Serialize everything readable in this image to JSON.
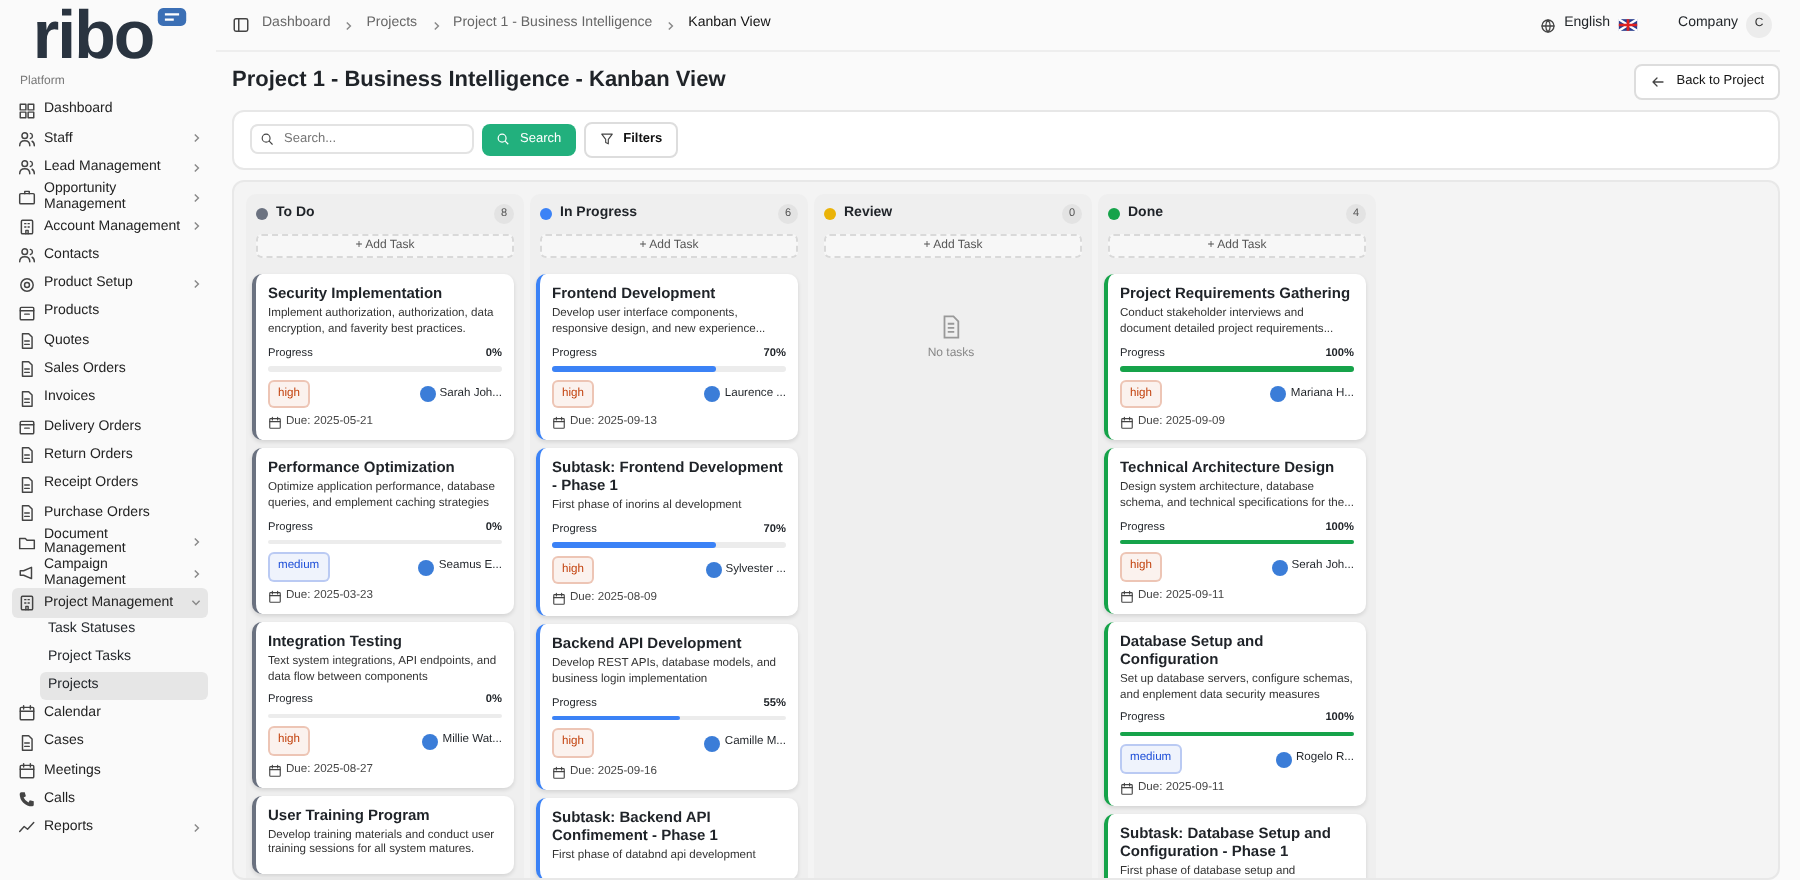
{
  "sidebar": {
    "logo": "ribo",
    "section": "Platform",
    "items": [
      {
        "label": "Dashboard",
        "kind": "link",
        "selected": false
      },
      {
        "label": "Staff",
        "kind": "group",
        "expanded": false,
        "selected": false
      },
      {
        "label": "Lead Management",
        "kind": "group",
        "expanded": false,
        "selected": false
      },
      {
        "label": "Opportunity Management",
        "kind": "group",
        "expanded": false,
        "selected": false
      },
      {
        "label": "Account Management",
        "kind": "group",
        "expanded": false,
        "selected": false
      },
      {
        "label": "Contacts",
        "kind": "link",
        "selected": false
      },
      {
        "label": "Product Setup",
        "kind": "group",
        "expanded": false,
        "selected": false
      },
      {
        "label": "Products",
        "kind": "link",
        "selected": false
      },
      {
        "label": "Quotes",
        "kind": "link",
        "selected": false
      },
      {
        "label": "Sales Orders",
        "kind": "link",
        "selected": false
      },
      {
        "label": "Invoices",
        "kind": "link",
        "selected": false
      },
      {
        "label": "Delivery Orders",
        "kind": "link",
        "selected": false
      },
      {
        "label": "Return Orders",
        "kind": "link",
        "selected": false
      },
      {
        "label": "Receipt Orders",
        "kind": "link",
        "selected": false
      },
      {
        "label": "Purchase Orders",
        "kind": "link",
        "selected": false
      },
      {
        "label": "Document Management",
        "kind": "group",
        "expanded": false,
        "selected": false
      },
      {
        "label": "Campaign Management",
        "kind": "group",
        "expanded": false,
        "selected": false
      },
      {
        "label": "Project Management",
        "kind": "group",
        "expanded": true,
        "selected": true,
        "children": [
          {
            "label": "Task Statuses",
            "selected": false
          },
          {
            "label": "Project Tasks",
            "selected": false
          },
          {
            "label": "Projects",
            "selected": true
          }
        ]
      },
      {
        "label": "Calendar",
        "kind": "link",
        "selected": false
      },
      {
        "label": "Cases",
        "kind": "link",
        "selected": false
      },
      {
        "label": "Meetings",
        "kind": "link",
        "selected": false
      },
      {
        "label": "Calls",
        "kind": "link",
        "selected": false
      },
      {
        "label": "Reports",
        "kind": "group",
        "expanded": false,
        "selected": false
      }
    ]
  },
  "breadcrumbs": [
    "Dashboard",
    "Projects",
    "Project 1 - Business Intelligence",
    "Kanban View"
  ],
  "header": {
    "language": "English",
    "company": "Company",
    "avatar": "C"
  },
  "title": "Project 1 - Business Intelligence - Kanban View",
  "back_button": "Back to Project",
  "search": {
    "placeholder": "Search...",
    "button": "Search",
    "filters": "Filters"
  },
  "columns": [
    {
      "name": "To Do",
      "count": "8",
      "color": "#6b7280",
      "add": "+ Add Task",
      "cards": [
        {
          "title": "Security Implementation",
          "description": "Implement authorization, authorization, data encryption, and faverity best practices.",
          "progress_label": "Progress",
          "progress": "0%",
          "level": 0,
          "priority": {
            "label": "high",
            "color": "#c2410c"
          },
          "assignee": "Sarah Joh...",
          "due": "Due: 2025-05-21"
        },
        {
          "title": "Performance Optimization",
          "description": "Optimize application performance, database queries, and emplement caching strategies",
          "progress_label": "Progress",
          "progress": "0%",
          "level": 0,
          "priority": {
            "label": "medium",
            "color": "#1d4ed8"
          },
          "assignee": "Seamus E...",
          "due": "Due: 2025-03-23"
        },
        {
          "title": "Integration Testing",
          "description": "Text system integrations, API endpoints, and data flow between components",
          "progress_label": "Progress",
          "progress": "0%",
          "level": 0,
          "priority": {
            "label": "high",
            "color": "#c2410c"
          },
          "assignee": "Millie Wat...",
          "due": "Due: 2025-08-27"
        },
        {
          "title": "User Training Program",
          "description": "Develop training materials and conduct user training sessions for all system matures."
        }
      ]
    },
    {
      "name": "In Progress",
      "count": "6",
      "color": "#3b82f6",
      "add": "+ Add Task",
      "cards": [
        {
          "title": "Frontend Development",
          "description": "Develop user interface components, responsive design, and new experience...",
          "progress_label": "Progress",
          "progress": "70%",
          "level": 0.7,
          "priority": {
            "label": "high",
            "color": "#c2410c"
          },
          "assignee": "Laurence ...",
          "due": "Due: 2025-09-13"
        },
        {
          "title": "Subtask: Frontend Development - Phase 1",
          "description": "First phase of inorins al development",
          "progress_label": "Progress",
          "progress": "70%",
          "level": 0.7,
          "priority": {
            "label": "high",
            "color": "#c2410c"
          },
          "assignee": "Sylvester ...",
          "due": "Due: 2025-08-09"
        },
        {
          "title": "Backend API Development",
          "description": "Develop REST APIs, database models, and business login implementation",
          "progress_label": "Progress",
          "progress": "55%",
          "level": 0.55,
          "priority": {
            "label": "high",
            "color": "#c2410c"
          },
          "assignee": "Camille M...",
          "due": "Due: 2025-09-16"
        },
        {
          "title": "Subtask: Backend API Confimement - Phase 1",
          "description": "First phase of databnd api development"
        }
      ]
    },
    {
      "name": "Review",
      "count": "0",
      "color": "#eab308",
      "add": "+ Add Task",
      "empty": "No tasks"
    },
    {
      "name": "Done",
      "count": "4",
      "color": "#16a34a",
      "add": "+ Add Task",
      "cards": [
        {
          "title": "Project Requirements Gathering",
          "description": "Conduct stakeholder interviews and document detailed project requirements...",
          "progress_label": "Progress",
          "progress": "100%",
          "level": 1,
          "priority": {
            "label": "high",
            "color": "#c2410c"
          },
          "assignee": "Mariana H...",
          "due": "Due: 2025-09-09"
        },
        {
          "title": "Technical Architecture Design",
          "description": "Design system architecture, database schema, and technical specifications for the...",
          "progress_label": "Progress",
          "progress": "100%",
          "level": 1,
          "priority": {
            "label": "high",
            "color": "#c2410c"
          },
          "assignee": "Serah Joh...",
          "due": "Due: 2025-09-11"
        },
        {
          "title": "Database Setup and Configuration",
          "description": "Set up database servers, configure schemas, and enplement data security measures",
          "progress_label": "Progress",
          "progress": "100%",
          "level": 1,
          "priority": {
            "label": "medium",
            "color": "#1d4ed8"
          },
          "assignee": "Rogelo R...",
          "due": "Due: 2025-09-11"
        },
        {
          "title": "Subtask: Database Setup and Configuration - Phase 1",
          "description": "First phase of database setup and"
        }
      ]
    }
  ]
}
